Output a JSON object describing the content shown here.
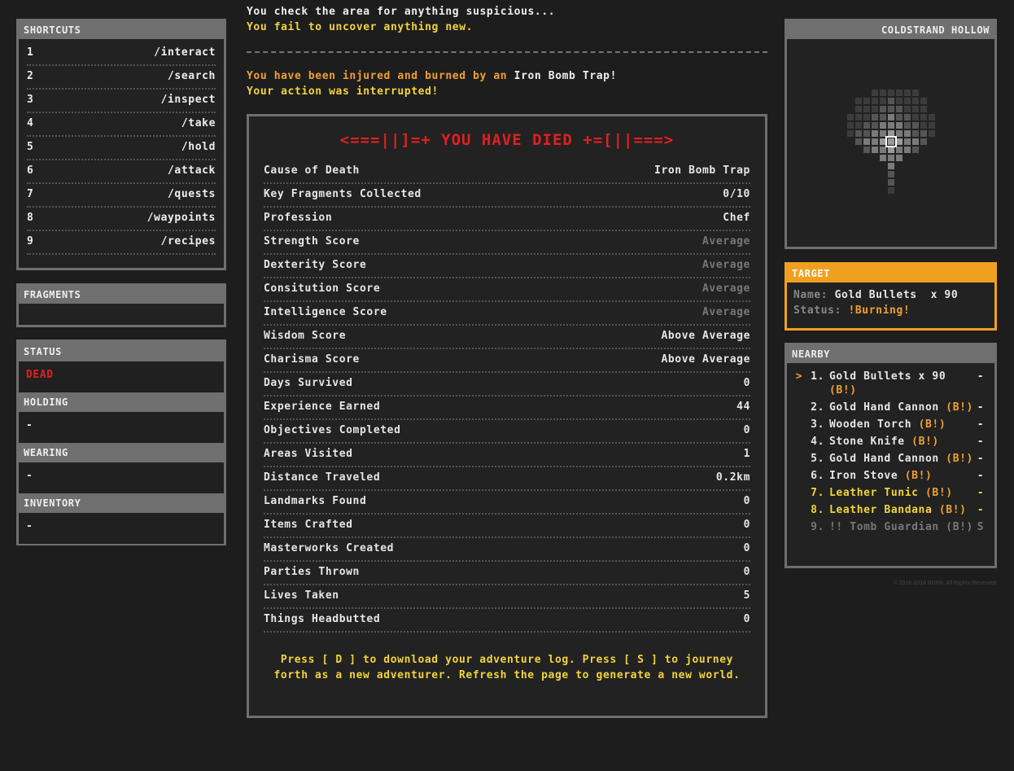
{
  "messages": {
    "line1": "You check the area for anything suspicious...",
    "line2": "You fail to uncover anything new.",
    "line3a": "You have been injured and burned by an ",
    "line3b": "Iron Bomb Trap!",
    "line4": "Your action was interrupted!"
  },
  "shortcuts": {
    "title": "SHORTCUTS",
    "items": [
      {
        "key": "1",
        "cmd": "/interact"
      },
      {
        "key": "2",
        "cmd": "/search"
      },
      {
        "key": "3",
        "cmd": "/inspect"
      },
      {
        "key": "4",
        "cmd": "/take"
      },
      {
        "key": "5",
        "cmd": "/hold"
      },
      {
        "key": "6",
        "cmd": "/attack"
      },
      {
        "key": "7",
        "cmd": "/quests"
      },
      {
        "key": "8",
        "cmd": "/waypoints"
      },
      {
        "key": "9",
        "cmd": "/recipes"
      }
    ]
  },
  "fragments": {
    "title": "FRAGMENTS"
  },
  "status": {
    "title": "STATUS",
    "value": "DEAD",
    "holding_title": "HOLDING",
    "holding": "-",
    "wearing_title": "WEARING",
    "wearing": "-",
    "inventory_title": "INVENTORY",
    "inventory": "-"
  },
  "death": {
    "title": "<===||]=+ YOU HAVE DIED +=[||===>",
    "stats": [
      {
        "label": "Cause of Death",
        "value": "Iron Bomb Trap"
      },
      {
        "label": "Key Fragments Collected",
        "value": "0/10"
      },
      {
        "label": "Profession",
        "value": "Chef"
      },
      {
        "label": "Strength Score",
        "value": "Average"
      },
      {
        "label": "Dexterity Score",
        "value": "Average"
      },
      {
        "label": "Consitution Score",
        "value": "Average"
      },
      {
        "label": "Intelligence Score",
        "value": "Average"
      },
      {
        "label": "Wisdom Score",
        "value": "Above Average"
      },
      {
        "label": "Charisma Score",
        "value": "Above Average"
      },
      {
        "label": "Days Survived",
        "value": "0"
      },
      {
        "label": "Experience Earned",
        "value": "44"
      },
      {
        "label": "Objectives Completed",
        "value": "0"
      },
      {
        "label": "Areas Visited",
        "value": "1"
      },
      {
        "label": "Distance Traveled",
        "value": "0.2km"
      },
      {
        "label": "Landmarks Found",
        "value": "0"
      },
      {
        "label": "Items Crafted",
        "value": "0"
      },
      {
        "label": "Masterworks Created",
        "value": "0"
      },
      {
        "label": "Parties Thrown",
        "value": "0"
      },
      {
        "label": "Lives Taken",
        "value": "5"
      },
      {
        "label": "Things Headbutted",
        "value": "0"
      }
    ],
    "footer": "Press [ D ] to download your adventure log. Press [ S ] to journey forth as a new adventurer. Refresh the page to generate a new world."
  },
  "map": {
    "title": "COLDSTRAND HOLLOW"
  },
  "target": {
    "title": "TARGET",
    "name_label": "Name:",
    "name": "Gold Bullets",
    "qty": "x 90",
    "status_label": "Status:",
    "status": "!Burning!"
  },
  "nearby": {
    "title": "NEARBY",
    "items": [
      {
        "arrow": ">",
        "num": "1.",
        "name": "Gold Bullets x 90",
        "badge": "(B!)",
        "end": "-",
        "style": "white"
      },
      {
        "arrow": "",
        "num": "2.",
        "name": "Gold Hand Cannon",
        "badge": "(B!)",
        "end": "-",
        "style": "white"
      },
      {
        "arrow": "",
        "num": "3.",
        "name": "Wooden Torch",
        "badge": "(B!)",
        "end": "-",
        "style": "white"
      },
      {
        "arrow": "",
        "num": "4.",
        "name": "Stone Knife",
        "badge": "(B!)",
        "end": "-",
        "style": "white"
      },
      {
        "arrow": "",
        "num": "5.",
        "name": "Gold Hand Cannon",
        "badge": "(B!)",
        "end": "-",
        "style": "white"
      },
      {
        "arrow": "",
        "num": "6.",
        "name": "Iron Stove",
        "badge": "(B!)",
        "end": "-",
        "style": "white"
      },
      {
        "arrow": "",
        "num": "7.",
        "name": "Leather Tunic",
        "badge": "(B!)",
        "end": "-",
        "style": "yellow"
      },
      {
        "arrow": "",
        "num": "8.",
        "name": "Leather Bandana",
        "badge": "(B!)",
        "end": "-",
        "style": "yellow"
      },
      {
        "arrow": "",
        "num": "9.",
        "name": "!! Tomb Guardian",
        "badge": "(B!)",
        "end": "S",
        "style": "dim"
      }
    ]
  },
  "copyright": "© 2016-2018 BDFR. All Rights Reserved"
}
